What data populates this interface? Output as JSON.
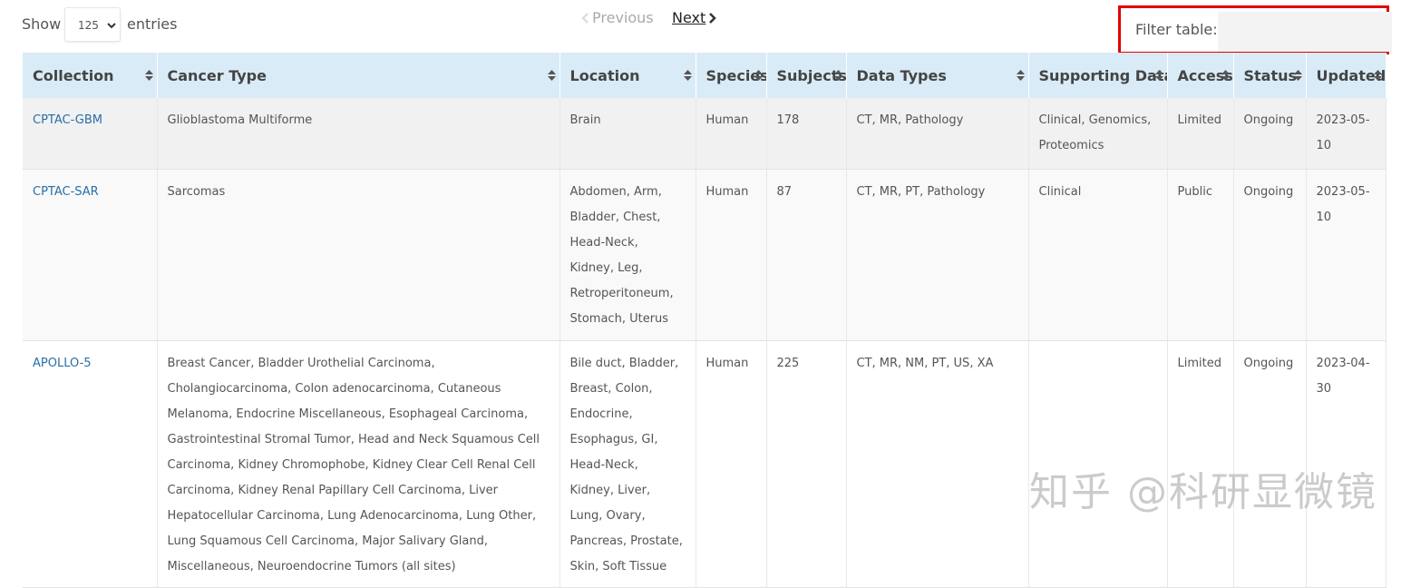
{
  "controls": {
    "show_label": "Show",
    "page_size": "125",
    "entries_label": "entries",
    "previous_label": "Previous",
    "next_label": "Next",
    "filter_label": "Filter table:",
    "filter_value": ""
  },
  "table": {
    "columns": [
      "Collection",
      "Cancer Type",
      "Location",
      "Species",
      "Subjects",
      "Data Types",
      "Supporting Data",
      "Access",
      "Status",
      "Updated"
    ],
    "rows": [
      {
        "collection": "CPTAC-GBM",
        "cancer_type": "Glioblastoma Multiforme",
        "location": "Brain",
        "species": "Human",
        "subjects": "178",
        "data_types": "CT, MR, Pathology",
        "supporting_data": "Clinical, Genomics, Proteomics",
        "access": "Limited",
        "status": "Ongoing",
        "updated": "2023-05-10"
      },
      {
        "collection": "CPTAC-SAR",
        "cancer_type": "Sarcomas",
        "location": "Abdomen, Arm, Bladder, Chest, Head-Neck, Kidney, Leg, Retroperitoneum, Stomach, Uterus",
        "species": "Human",
        "subjects": "87",
        "data_types": "CT, MR, PT, Pathology",
        "supporting_data": "Clinical",
        "access": "Public",
        "status": "Ongoing",
        "updated": "2023-05-10"
      },
      {
        "collection": "APOLLO-5",
        "cancer_type": "Breast Cancer, Bladder Urothelial Carcinoma, Cholangiocarcinoma, Colon adenocarcinoma, Cutaneous Melanoma, Endocrine Miscellaneous, Esophageal Carcinoma, Gastrointestinal Stromal Tumor, Head and Neck Squamous Cell Carcinoma, Kidney Chromophobe, Kidney Clear Cell Renal Cell Carcinoma, Kidney Renal Papillary Cell Carcinoma, Liver Hepatocellular Carcinoma, Lung Adenocarcinoma, Lung Other, Lung Squamous Cell Carcinoma, Major Salivary Gland, Miscellaneous, Neuroendocrine Tumors (all sites)",
        "location": "Bile duct, Bladder, Breast, Colon, Endocrine, Esophagus, GI, Head-Neck, Kidney, Liver, Lung, Ovary, Pancreas, Prostate, Skin, Soft Tissue",
        "species": "Human",
        "subjects": "225",
        "data_types": "CT, MR, NM, PT, US, XA",
        "supporting_data": "",
        "access": "Limited",
        "status": "Ongoing",
        "updated": "2023-04-30"
      }
    ]
  },
  "watermark": "知乎 @科研显微镜",
  "colors": {
    "header_bg": "#d9ebf6",
    "link": "#2a6ea6",
    "highlight_border": "#e00000"
  }
}
